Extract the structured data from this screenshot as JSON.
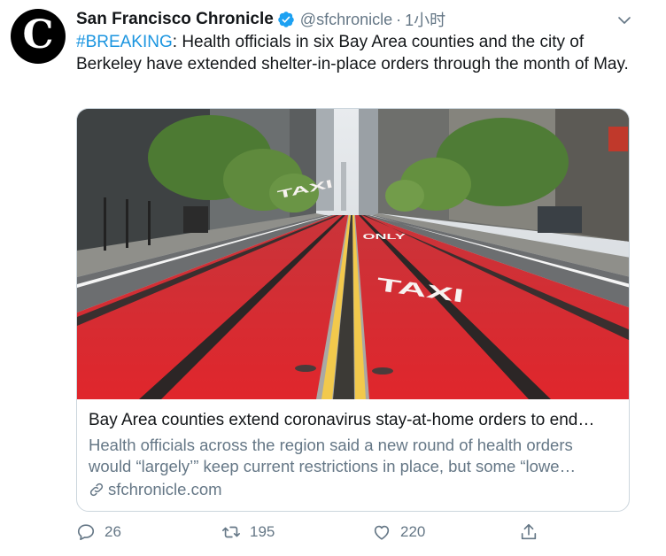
{
  "tweet": {
    "author_name": "San Francisco Chronicle",
    "handle": "@sfchronicle",
    "separator": "·",
    "time": "1小时",
    "avatar_letter": "C",
    "hashtag": "#BREAKING",
    "text_rest": ": Health officials in six Bay Area counties and the city of Berkeley have extended shelter-in-place orders through the month of May."
  },
  "card": {
    "title": "Bay Area counties extend coronavirus stay-at-home orders to end…",
    "description_line1": "Health officials across the region said a new round of health orders",
    "description_line2": "would “largely’” keep current restrictions in place, but some “lowe…",
    "domain": "sfchronicle.com",
    "image_road_text_left": "TAXI",
    "image_road_text_center": "ONLY",
    "image_road_text_right": "TAXI"
  },
  "actions": {
    "replies": "26",
    "retweets": "195",
    "likes": "220"
  },
  "colors": {
    "link_blue": "#1b95e0",
    "secondary_gray": "#657786",
    "verified_blue": "#1da1f2",
    "lane_red": "#d8232a"
  },
  "icons": [
    "verified-badge-icon",
    "chevron-down-icon",
    "link-icon",
    "reply-icon",
    "retweet-icon",
    "like-icon",
    "share-icon"
  ]
}
